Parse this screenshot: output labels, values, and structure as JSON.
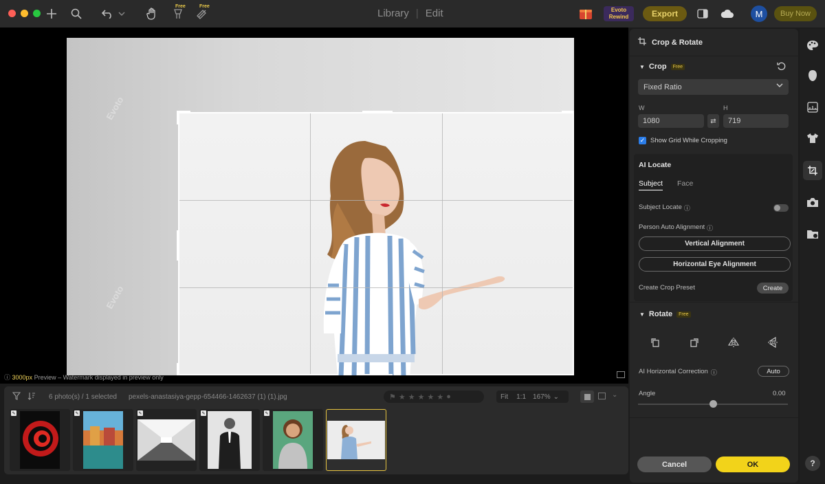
{
  "topbar": {
    "modes": [
      "Library",
      "Edit"
    ],
    "export_label": "Export",
    "buy_now_label": "Buy Now",
    "avatar_initial": "M",
    "free_tag": "Free",
    "rewind_label": "Evoto Rewind"
  },
  "canvas": {
    "preview_size": "3000px",
    "preview_note": " Preview – Watermark displayed in preview only",
    "watermark": "Evoto"
  },
  "filmstrip": {
    "count_text": "6 photo(s) / 1 selected",
    "filename": "pexels-anastasiya-gepp-654466-1462637 (1) (1).jpg",
    "fit_label": "Fit",
    "one_to_one_label": "1:1",
    "zoom_value": "167%",
    "thumbnails": [
      "red-spiral",
      "colorful-buildings",
      "corridor",
      "man-suit",
      "woman-smiling",
      "woman-pointing"
    ]
  },
  "panel": {
    "title": "Crop & Rotate",
    "crop": {
      "title": "Crop",
      "free": "Free",
      "ratio_value": "Fixed Ratio",
      "w_label": "W",
      "h_label": "H",
      "w_value": "1080",
      "h_value": "719",
      "show_grid_label": "Show Grid While Cropping"
    },
    "ai_locate": {
      "title": "AI Locate",
      "tab_subject": "Subject",
      "tab_face": "Face",
      "subject_locate_label": "Subject Locate",
      "person_auto_label": "Person Auto Alignment",
      "vertical_btn": "Vertical Alignment",
      "horizontal_btn": "Horizontal Eye Alignment"
    },
    "create_crop_preset_label": "Create Crop Preset",
    "create_btn": "Create",
    "rotate": {
      "title": "Rotate",
      "free": "Free",
      "ai_horizontal_label": "AI Horizontal Correction",
      "auto_btn": "Auto",
      "angle_label": "Angle",
      "angle_value": "0.00"
    },
    "cancel_label": "Cancel",
    "ok_label": "OK"
  },
  "rail": {
    "help_label": "?"
  },
  "colors": {
    "accent_yellow": "#f2d31a",
    "accent_blue": "#2b7de9",
    "traffic_red": "#fe5f57",
    "traffic_yellow": "#febc2e",
    "traffic_green": "#28c840"
  }
}
